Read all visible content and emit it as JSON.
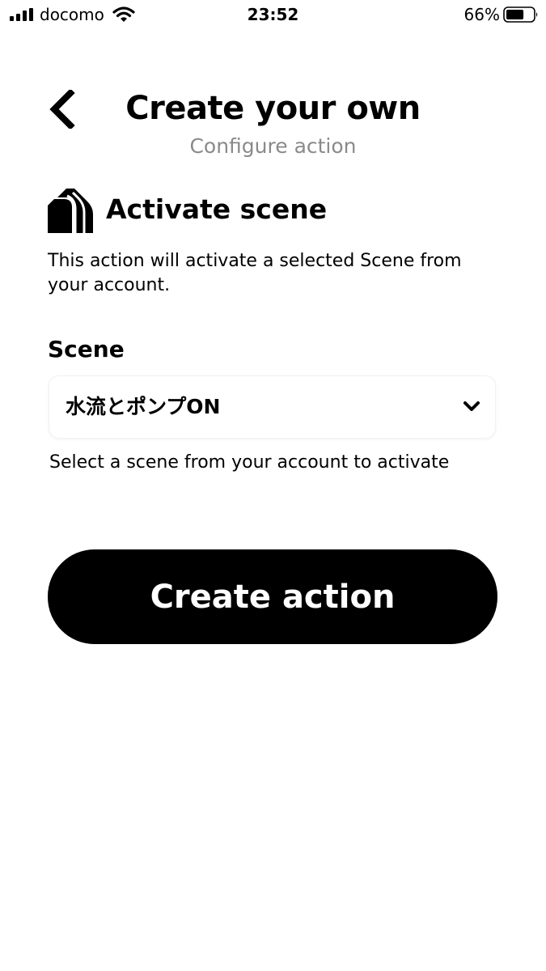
{
  "status_bar": {
    "carrier": "docomo",
    "time": "23:52",
    "battery_percent": "66%",
    "battery_level": 0.66,
    "icons": [
      "signal-icon",
      "wifi-icon",
      "battery-icon"
    ]
  },
  "header": {
    "back_icon": "chevron-left-icon",
    "title": "Create your own",
    "subtitle": "Configure action"
  },
  "action": {
    "icon": "service-logo-icon",
    "name": "Activate scene",
    "description": "This action will activate a selected Scene from your account."
  },
  "field": {
    "label": "Scene",
    "selected_value": "水流とポンプON",
    "chevron_icon": "chevron-down-icon",
    "help_text": "Select a scene from your account to activate"
  },
  "primary_button": {
    "label": "Create action"
  },
  "colors": {
    "text": "#000000",
    "subtitle": "#8a8a8a",
    "button_bg": "#000000",
    "button_text": "#ffffff",
    "background": "#ffffff"
  }
}
